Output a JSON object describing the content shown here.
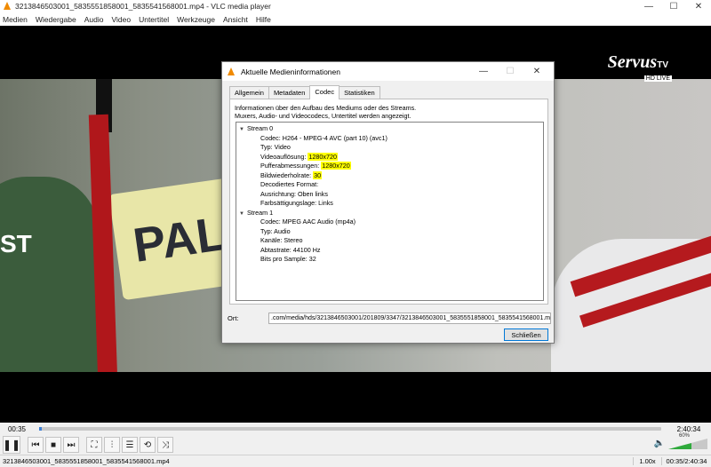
{
  "window": {
    "title": "3213846503001_5835551858001_5835541568001.mp4 - VLC media player",
    "minimize": "—",
    "maximize": "☐",
    "close": "✕"
  },
  "menu": [
    "Medien",
    "Wiedergabe",
    "Audio",
    "Video",
    "Untertitel",
    "Werkzeuge",
    "Ansicht",
    "Hilfe"
  ],
  "video": {
    "logo_main": "Servus",
    "logo_tv": "TV",
    "logo_sub": "HD LIVE",
    "board_text": "PAL",
    "jersey_text": "ST"
  },
  "dialog": {
    "title": "Aktuelle Medieninformationen",
    "tabs": [
      "Allgemein",
      "Metadaten",
      "Codec",
      "Statistiken"
    ],
    "active_tab": "Codec",
    "info_line1": "Informationen über den Aufbau des Mediums oder des Streams.",
    "info_line2": "Muxers, Audio- und Videocodecs, Untertitel werden angezeigt.",
    "stream0": {
      "label": "Stream 0",
      "codec": "Codec: H264 - MPEG-4 AVC (part 10) (avc1)",
      "type": "Typ: Video",
      "res_label": "Videoauflösung: ",
      "res_value": "1280x720",
      "buf_label": "Pufferabmessungen: ",
      "buf_value": "1280x720",
      "fps_label": "Bildwiederholrate: ",
      "fps_value": "30",
      "decoded": "Decodiertes Format:",
      "orientation": "Ausrichtung: Oben links",
      "chroma": "Farbsättigungslage: Links"
    },
    "stream1": {
      "label": "Stream 1",
      "codec": "Codec: MPEG AAC Audio (mp4a)",
      "type": "Typ: Audio",
      "channels": "Kanäle: Stereo",
      "rate": "Abtastrate: 44100 Hz",
      "bits": "Bits pro Sample: 32"
    },
    "ort_label": "Ort:",
    "ort_value": ".com/media/hds/3213846503001/201809/3347/3213846503001_5835551858001_5835541568001.mp4",
    "close_label": "Schließen"
  },
  "player": {
    "elapsed": "00:35",
    "total": "2:40:34",
    "progress": 0.004,
    "volume_pct": "60%",
    "volume": 0.6
  },
  "status": {
    "file": "3213846503001_5835551858001_5835541568001.mp4",
    "speed": "1.00x",
    "time": "00:35/2:40:34"
  }
}
